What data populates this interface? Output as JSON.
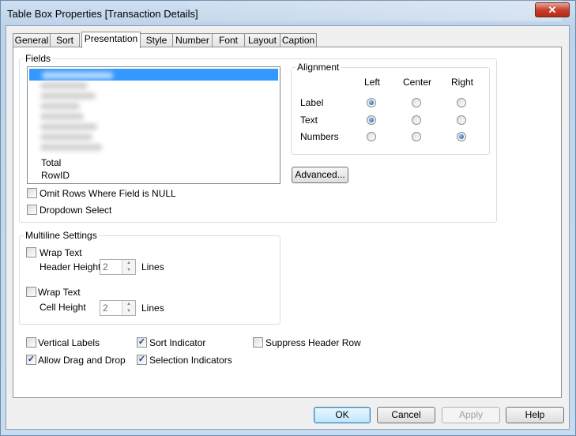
{
  "window": {
    "title": "Table Box Properties [Transaction Details]",
    "close_glyph": "✕"
  },
  "tabs": [
    {
      "label": "General"
    },
    {
      "label": "Sort"
    },
    {
      "label": "Presentation"
    },
    {
      "label": "Style"
    },
    {
      "label": "Number"
    },
    {
      "label": "Font"
    },
    {
      "label": "Layout"
    },
    {
      "label": "Caption"
    }
  ],
  "active_tab": "Presentation",
  "fields": {
    "group_label": "Fields",
    "items": [
      "Total",
      "RowID"
    ],
    "omit_rows_label": "Omit Rows Where Field is NULL",
    "omit_rows_checked": false,
    "dropdown_select_label": "Dropdown Select",
    "dropdown_select_checked": false
  },
  "alignment": {
    "group_label": "Alignment",
    "columns": [
      "Left",
      "Center",
      "Right"
    ],
    "rows": [
      {
        "label": "Label",
        "selected": "Left"
      },
      {
        "label": "Text",
        "selected": "Left"
      },
      {
        "label": "Numbers",
        "selected": "Right"
      }
    ],
    "advanced_button": "Advanced..."
  },
  "multiline": {
    "group_label": "Multiline Settings",
    "header_wrap_label": "Wrap Text",
    "header_height_label": "Header Height",
    "header_height_value": "2",
    "header_lines_label": "Lines",
    "cell_wrap_label": "Wrap Text",
    "cell_height_label": "Cell Height",
    "cell_height_value": "2",
    "cell_lines_label": "Lines"
  },
  "options": {
    "vertical_labels": {
      "label": "Vertical Labels",
      "checked": false
    },
    "allow_drag_drop": {
      "label": "Allow Drag and Drop",
      "checked": true
    },
    "sort_indicator": {
      "label": "Sort Indicator",
      "checked": true
    },
    "selection_indicators": {
      "label": "Selection Indicators",
      "checked": true
    },
    "suppress_header_row": {
      "label": "Suppress Header Row",
      "checked": false
    }
  },
  "buttons": {
    "ok": "OK",
    "cancel": "Cancel",
    "apply": "Apply",
    "help": "Help"
  },
  "check_glyph": "✓"
}
